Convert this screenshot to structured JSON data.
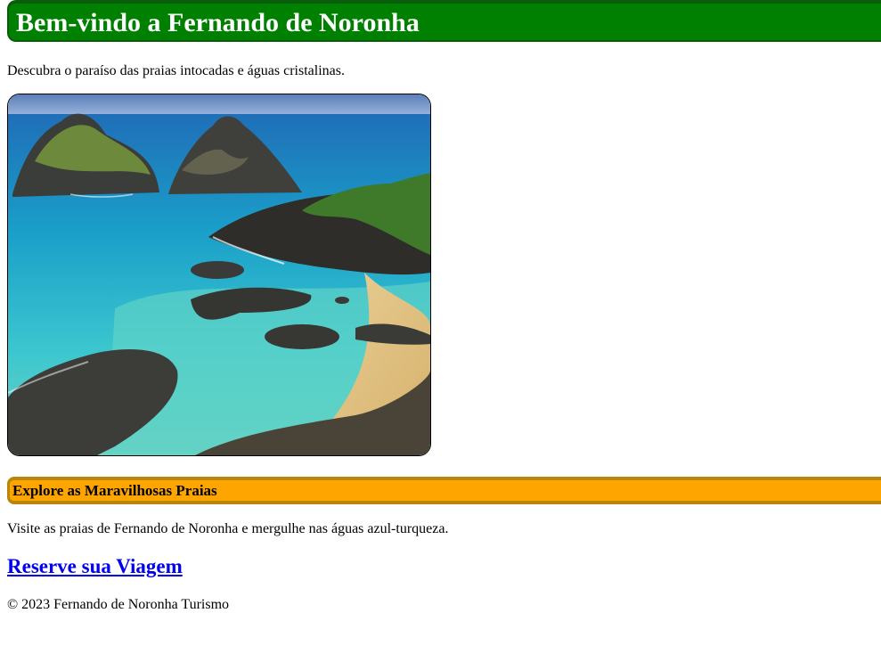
{
  "header": {
    "title": "Bem-vindo a Fernando de Noronha",
    "bg_color": "#008000"
  },
  "intro": {
    "text": "Descubra o paraíso das praias intocadas e águas cristalinas."
  },
  "hero_image": {
    "icon": "beach-landscape-image"
  },
  "section": {
    "title": "Explore as Maravilhosas Praias",
    "text": "Visite as praias de Fernando de Noronha e mergulhe nas águas azul-turqueza.",
    "bg_color": "#ffa500"
  },
  "cta": {
    "label": "Reserve sua Viagem",
    "color": "#0000ee"
  },
  "footer": {
    "text": "© 2023 Fernando de Noronha Turismo"
  }
}
